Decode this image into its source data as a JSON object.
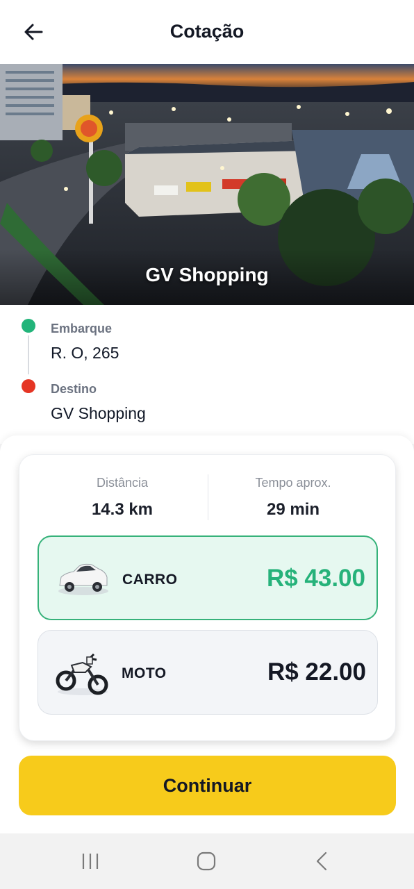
{
  "header": {
    "title": "Cotação",
    "back_icon": "arrow-left-icon"
  },
  "hero": {
    "caption": "GV Shopping",
    "image": "shopping-mall-photo"
  },
  "route": {
    "pickup": {
      "label": "Embarque",
      "value": "R. O, 265",
      "color": "#22b47a"
    },
    "destination": {
      "label": "Destino",
      "value": "GV Shopping",
      "color": "#e53524"
    }
  },
  "quote": {
    "distance": {
      "label": "Distância",
      "value": "14.3 km"
    },
    "time": {
      "label": "Tempo aprox.",
      "value": "29 min"
    },
    "options": [
      {
        "name": "CARRO",
        "price": "R$ 43.00",
        "icon": "car-icon",
        "selected": true
      },
      {
        "name": "MOTO",
        "price": "R$ 22.00",
        "icon": "motorcycle-icon",
        "selected": false
      }
    ]
  },
  "continue_label": "Continuar",
  "colors": {
    "accent": "#f7cb1b",
    "selected": "#26b27a"
  },
  "system_nav": {
    "icons": [
      "recent-apps-icon",
      "home-icon",
      "back-nav-icon"
    ]
  }
}
